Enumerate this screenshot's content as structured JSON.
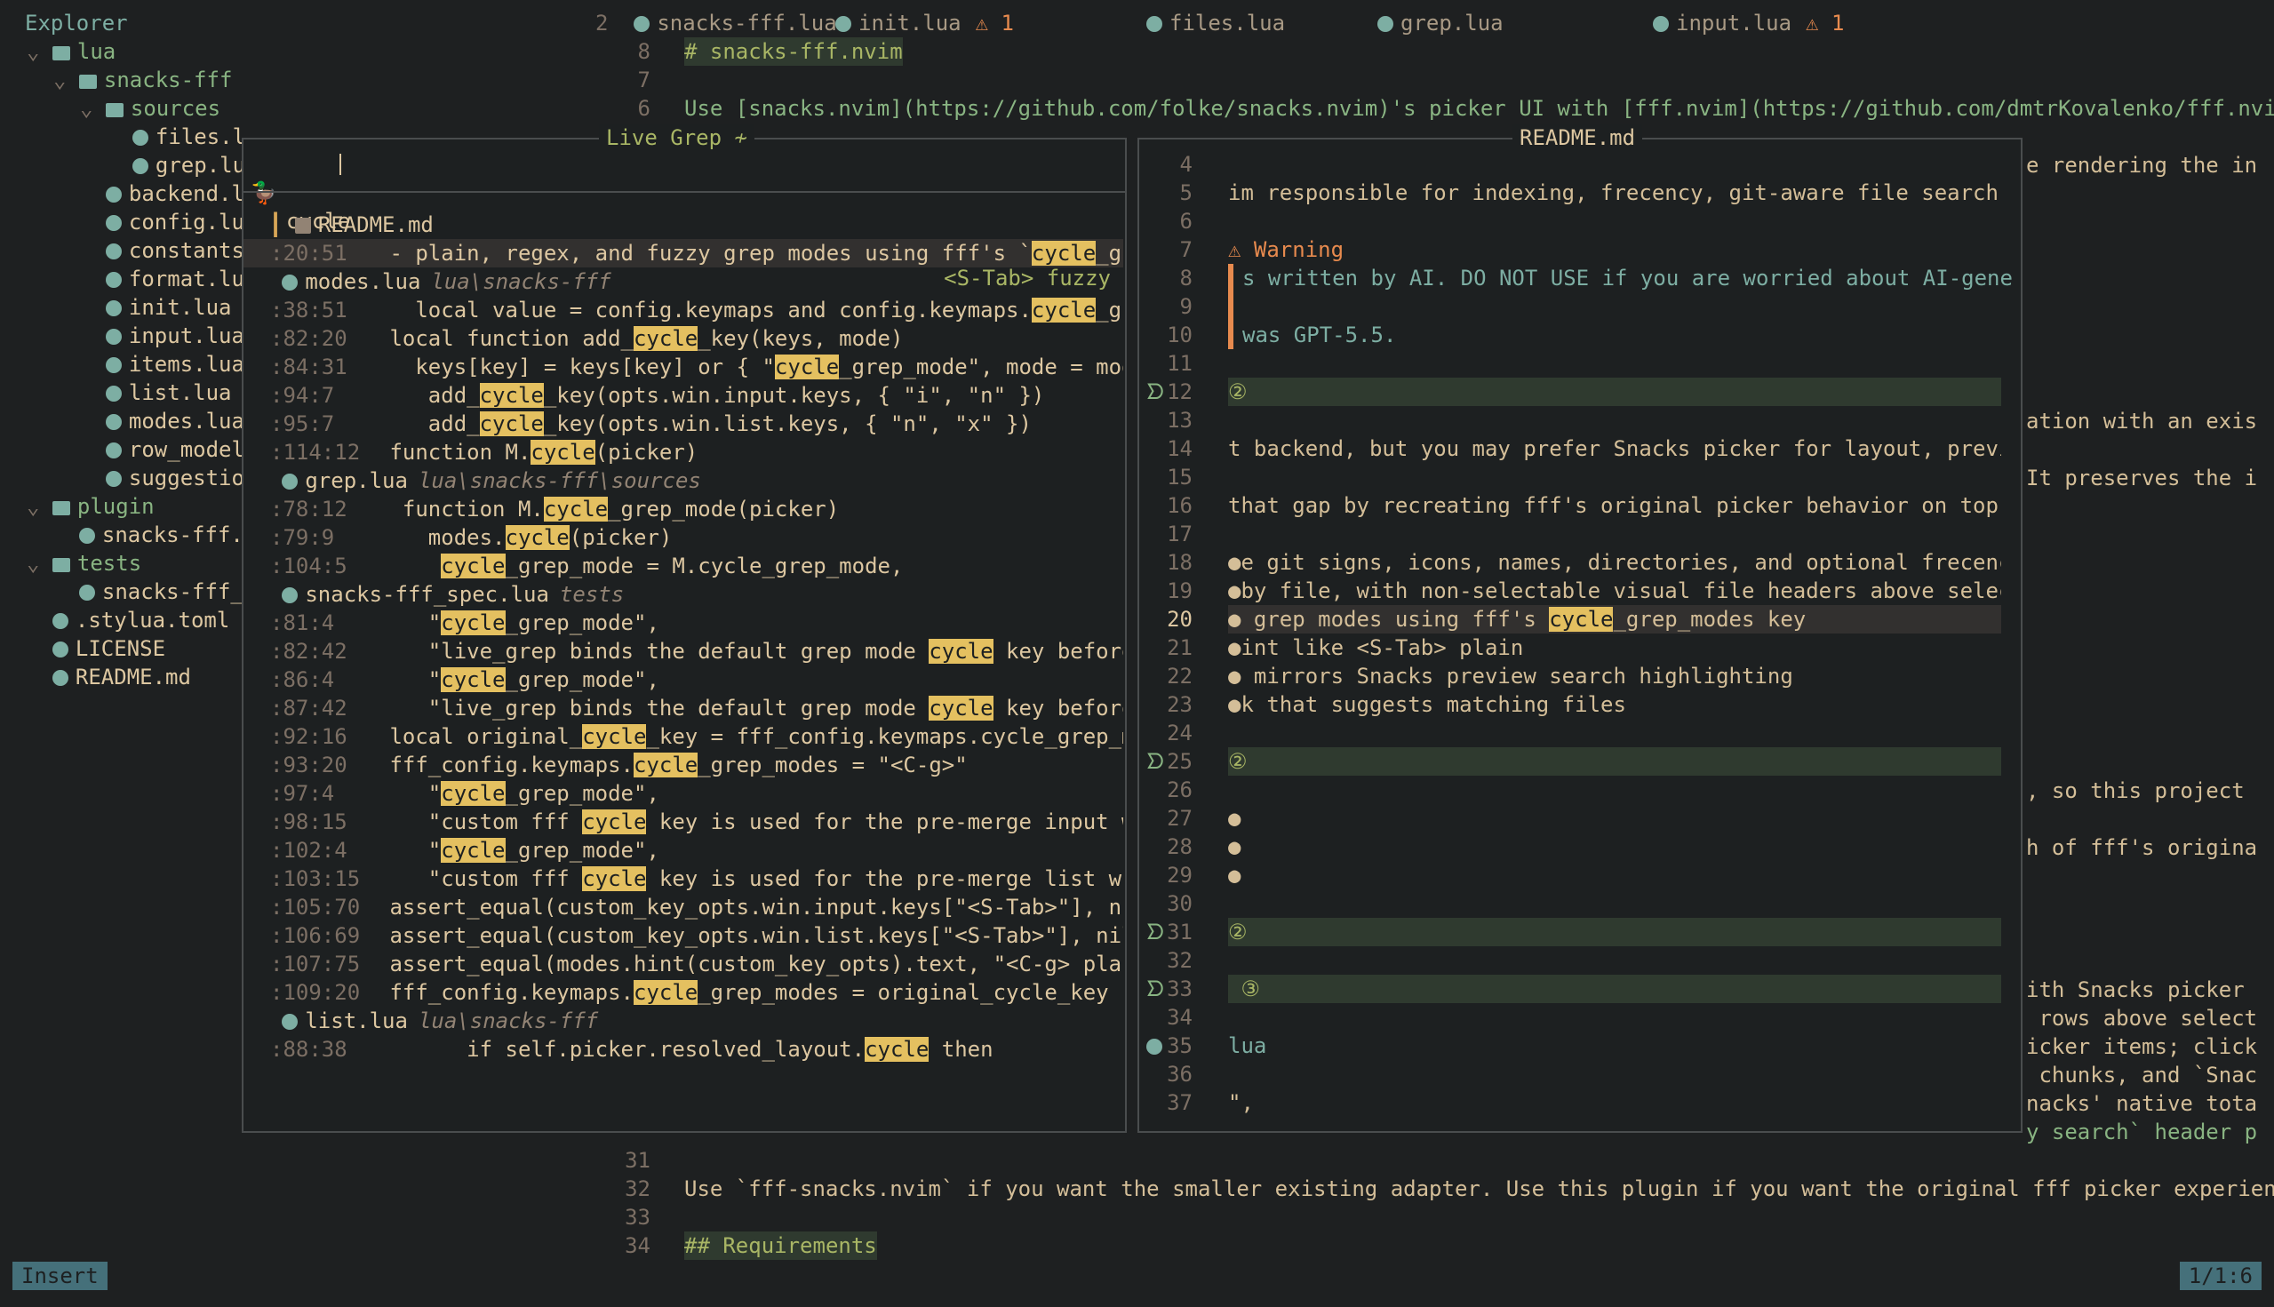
{
  "sidebar": {
    "title": "Explorer",
    "items": [
      {
        "label": "lua",
        "indent": 0,
        "type": "dir"
      },
      {
        "label": "snacks-fff",
        "indent": 1,
        "type": "dir"
      },
      {
        "label": "sources",
        "indent": 2,
        "type": "dir"
      },
      {
        "label": "files.l",
        "indent": 3,
        "type": "file"
      },
      {
        "label": "grep.lu",
        "indent": 3,
        "type": "file"
      },
      {
        "label": "backend.l",
        "indent": 2,
        "type": "file"
      },
      {
        "label": "config.lu",
        "indent": 2,
        "type": "file"
      },
      {
        "label": "constants",
        "indent": 2,
        "type": "file"
      },
      {
        "label": "format.lu",
        "indent": 2,
        "type": "file"
      },
      {
        "label": "init.lua",
        "indent": 2,
        "type": "file"
      },
      {
        "label": "input.lua",
        "indent": 2,
        "type": "file"
      },
      {
        "label": "items.lua",
        "indent": 2,
        "type": "file"
      },
      {
        "label": "list.lua",
        "indent": 2,
        "type": "file"
      },
      {
        "label": "modes.lua",
        "indent": 2,
        "type": "file"
      },
      {
        "label": "row_model",
        "indent": 2,
        "type": "file"
      },
      {
        "label": "suggestio",
        "indent": 2,
        "type": "file"
      },
      {
        "label": "plugin",
        "indent": 0,
        "type": "dir"
      },
      {
        "label": "snacks-fff.",
        "indent": 1,
        "type": "file"
      },
      {
        "label": "tests",
        "indent": 0,
        "type": "dir"
      },
      {
        "label": "snacks-fff_",
        "indent": 1,
        "type": "file"
      },
      {
        "label": ".stylua.toml",
        "indent": 0,
        "type": "file"
      },
      {
        "label": "LICENSE",
        "indent": 0,
        "type": "file"
      },
      {
        "label": "README.md",
        "indent": 0,
        "type": "file"
      }
    ]
  },
  "tabs": [
    {
      "num": "2",
      "label": "snacks-fff.lua",
      "warn": ""
    },
    {
      "num": "",
      "label": "init.lua",
      "warn": "⚠ 1"
    },
    {
      "num": "",
      "label": "files.lua",
      "warn": ""
    },
    {
      "num": "",
      "label": "grep.lua",
      "warn": ""
    },
    {
      "num": "",
      "label": "input.lua",
      "warn": "⚠ 1"
    }
  ],
  "editor": {
    "top_lines": [
      {
        "n": "8",
        "text": "# snacks-fff.nvim"
      },
      {
        "n": "7",
        "text": ""
      },
      {
        "n": "6",
        "text": "Use [snacks.nvim](https://github.com/folke/snacks.nvim)'s picker UI with [fff.nvim](https://github.com/dmtrKovalenko/fff.nvim)"
      }
    ],
    "right_fragments": [
      "e rendering the in",
      "ation with an exis",
      "It preserves the i",
      ", so this project",
      "h of fff's origina",
      "ith Snacks picker",
      " rows above select",
      "icker items; click",
      " chunks, and `Snac",
      "nacks' native tota",
      "y search` header p"
    ],
    "bottom_lines": [
      {
        "n": "31",
        "text": ""
      },
      {
        "n": "32",
        "text": "Use `fff-snacks.nvim` if you want the smaller existing adapter. Use this plugin if you want the original fff picker experience"
      },
      {
        "n": "33",
        "text": ""
      },
      {
        "n": "34",
        "text": "## Requirements"
      }
    ]
  },
  "picker": {
    "title": "Live Grep",
    "query": "cycle",
    "mode_hint": "<S-Tab> fuzzy",
    "results": [
      {
        "kind": "file",
        "name": "README.md",
        "path": ""
      },
      {
        "kind": "match",
        "loc": ":20:51",
        "text": " - plain, regex, and fuzzy grep modes using fff's `",
        "hl": "cycle",
        "rest": "_gre",
        "sel": true
      },
      {
        "kind": "file",
        "name": "modes.lua",
        "path": "lua\\snacks-fff"
      },
      {
        "kind": "match",
        "loc": ":38:51",
        "text": "   local value = config.keymaps and config.keymaps.",
        "hl": "cycle",
        "rest": "_gre"
      },
      {
        "kind": "match",
        "loc": ":82:20",
        "text": " local function add_",
        "hl": "cycle",
        "rest": "_key(keys, mode)"
      },
      {
        "kind": "match",
        "loc": ":84:31",
        "text": "   keys[key] = keys[key] or { \"",
        "hl": "cycle",
        "rest": "_grep_mode\", mode = mode"
      },
      {
        "kind": "match",
        "loc": ":94:7",
        "text": "    add_",
        "hl": "cycle",
        "rest": "_key(opts.win.input.keys, { \"i\", \"n\" })"
      },
      {
        "kind": "match",
        "loc": ":95:7",
        "text": "    add_",
        "hl": "cycle",
        "rest": "_key(opts.win.list.keys, { \"n\", \"x\" })"
      },
      {
        "kind": "match",
        "loc": ":114:12",
        "text": " function M.",
        "hl": "cycle",
        "rest": "(picker)"
      },
      {
        "kind": "file",
        "name": "grep.lua",
        "path": "lua\\snacks-fff\\sources"
      },
      {
        "kind": "match",
        "loc": ":78:12",
        "text": "  function M.",
        "hl": "cycle",
        "rest": "_grep_mode(picker)"
      },
      {
        "kind": "match",
        "loc": ":79:9",
        "text": "    modes.",
        "hl": "cycle",
        "rest": "(picker)"
      },
      {
        "kind": "match",
        "loc": ":104:5",
        "text": "     ",
        "hl": "cycle",
        "rest": "_grep_mode = M.cycle_grep_mode,"
      },
      {
        "kind": "file",
        "name": "snacks-fff_spec.lua",
        "path": "tests"
      },
      {
        "kind": "match",
        "loc": ":81:4",
        "text": "    \"",
        "hl": "cycle",
        "rest": "_grep_mode\","
      },
      {
        "kind": "match",
        "loc": ":82:42",
        "text": "    \"live_grep binds the default grep mode ",
        "hl": "cycle",
        "rest": " key before S"
      },
      {
        "kind": "match",
        "loc": ":86:4",
        "text": "    \"",
        "hl": "cycle",
        "rest": "_grep_mode\","
      },
      {
        "kind": "match",
        "loc": ":87:42",
        "text": "    \"live_grep binds the default grep mode ",
        "hl": "cycle",
        "rest": " key before S"
      },
      {
        "kind": "match",
        "loc": ":92:16",
        "text": " local original_",
        "hl": "cycle",
        "rest": "_key = fff_config.keymaps.cycle_grep_mo"
      },
      {
        "kind": "match",
        "loc": ":93:20",
        "text": " fff_config.keymaps.",
        "hl": "cycle",
        "rest": "_grep_modes = \"<C-g>\""
      },
      {
        "kind": "match",
        "loc": ":97:4",
        "text": "    \"",
        "hl": "cycle",
        "rest": "_grep_mode\","
      },
      {
        "kind": "match",
        "loc": ":98:15",
        "text": "    \"custom fff ",
        "hl": "cycle",
        "rest": " key is used for the pre-merge input win"
      },
      {
        "kind": "match",
        "loc": ":102:4",
        "text": "    \"",
        "hl": "cycle",
        "rest": "_grep_mode\","
      },
      {
        "kind": "match",
        "loc": ":103:15",
        "text": "    \"custom fff ",
        "hl": "cycle",
        "rest": " key is used for the pre-merge list wind"
      },
      {
        "kind": "match",
        "loc": ":105:70",
        "text": " assert_equal(custom_key_opts.win.input.keys[\"<S-Tab>\"], nil",
        "hl": "",
        "rest": ""
      },
      {
        "kind": "match",
        "loc": ":106:69",
        "text": " assert_equal(custom_key_opts.win.list.keys[\"<S-Tab>\"], nil,",
        "hl": "",
        "rest": ""
      },
      {
        "kind": "match",
        "loc": ":107:75",
        "text": " assert_equal(modes.hint(custom_key_opts).text, \"<C-g> plain",
        "hl": "",
        "rest": ""
      },
      {
        "kind": "match",
        "loc": ":109:20",
        "text": " fff_config.keymaps.",
        "hl": "cycle",
        "rest": "_grep_modes = original_cycle_key"
      },
      {
        "kind": "file",
        "name": "list.lua",
        "path": "lua\\snacks-fff"
      },
      {
        "kind": "match",
        "loc": ":88:38",
        "text": "       if self.picker.resolved_layout.",
        "hl": "cycle",
        "rest": " then"
      }
    ]
  },
  "preview": {
    "title": "README.md",
    "lines": [
      {
        "n": "4",
        "text": "",
        "style": ""
      },
      {
        "n": "5",
        "text": "im responsible for indexing, frecency, git-aware file search,",
        "style": ""
      },
      {
        "n": "6",
        "text": "",
        "style": ""
      },
      {
        "n": "7",
        "text": "⚠ Warning",
        "style": "warn"
      },
      {
        "n": "8",
        "text": "s written by AI. DO NOT USE if you are worried about AI-gener",
        "style": "quote"
      },
      {
        "n": "9",
        "text": "",
        "style": "quote"
      },
      {
        "n": "10",
        "text": "was GPT-5.5.",
        "style": "quote"
      },
      {
        "n": "11",
        "text": "",
        "style": ""
      },
      {
        "n": "12",
        "text": "②",
        "style": "head"
      },
      {
        "n": "13",
        "text": "",
        "style": ""
      },
      {
        "n": "14",
        "text": "t backend, but you may prefer Snacks picker for layout, previe",
        "style": ""
      },
      {
        "n": "15",
        "text": "",
        "style": ""
      },
      {
        "n": "16",
        "text": "that gap by recreating fff's original picker behavior on top o",
        "style": ""
      },
      {
        "n": "17",
        "text": "",
        "style": ""
      },
      {
        "n": "18",
        "text": "●e git signs, icons, names, directories, and optional frecency",
        "style": ""
      },
      {
        "n": "19",
        "text": "●by file, with non-selectable visual file headers above select",
        "style": ""
      },
      {
        "n": "20",
        "text": "● grep modes using fff's ",
        "style": "cur",
        "hl": "cycle",
        "rest": "_grep_modes key"
      },
      {
        "n": "21",
        "text": "●int like <S-Tab> plain",
        "style": ""
      },
      {
        "n": "22",
        "text": "● mirrors Snacks preview search highlighting",
        "style": ""
      },
      {
        "n": "23",
        "text": "●k that suggests matching files",
        "style": ""
      },
      {
        "n": "24",
        "text": "",
        "style": ""
      },
      {
        "n": "25",
        "text": "②",
        "style": "head"
      },
      {
        "n": "26",
        "text": "",
        "style": ""
      },
      {
        "n": "27",
        "text": "●",
        "style": ""
      },
      {
        "n": "28",
        "text": "●",
        "style": ""
      },
      {
        "n": "29",
        "text": "●",
        "style": ""
      },
      {
        "n": "30",
        "text": "",
        "style": ""
      },
      {
        "n": "31",
        "text": "②",
        "style": "head"
      },
      {
        "n": "32",
        "text": "",
        "style": ""
      },
      {
        "n": "33",
        "text": " ③",
        "style": "head"
      },
      {
        "n": "34",
        "text": "",
        "style": ""
      },
      {
        "n": "35",
        "text": "lua",
        "style": "lua"
      },
      {
        "n": "36",
        "text": "",
        "style": ""
      },
      {
        "n": "37",
        "text": "\",",
        "style": ""
      }
    ]
  },
  "status": {
    "mode": "Insert",
    "position": "1/1:6"
  }
}
